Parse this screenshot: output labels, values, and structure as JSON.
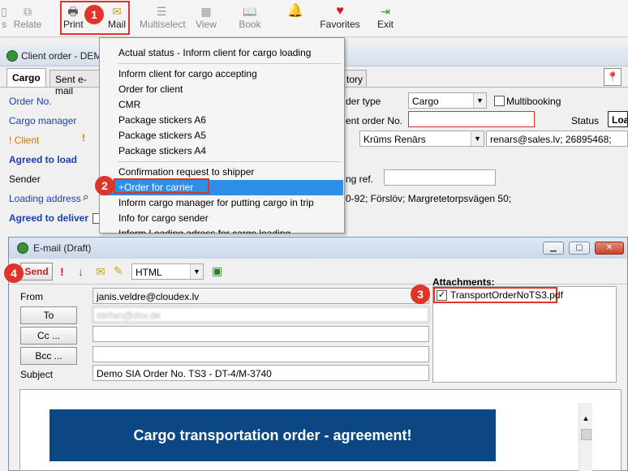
{
  "toolbar": {
    "relate": "Relate",
    "print": "Print",
    "mail": "Mail",
    "multiselect": "Multiselect",
    "view": "View",
    "book": "Book",
    "favorites": "Favorites",
    "exit": "Exit"
  },
  "steps": {
    "s1": "1",
    "s2": "2",
    "s3": "3",
    "s4": "4"
  },
  "client_order": {
    "title": "Client order - DEM",
    "tabs": {
      "cargo": "Cargo",
      "sent_email": "Sent e-mail",
      "history": "tory"
    },
    "labels": {
      "order_no": "Order No.",
      "cargo_manager": "Cargo manager",
      "client": "! Client",
      "agreed_to_load": "Agreed to load",
      "sender": "Sender",
      "loading_address": "Loading address",
      "agreed_to_deliver": "Agreed to deliver",
      "order_type": "der type",
      "client_order_no": "ent order No.",
      "status": "Status",
      "ref": "ng ref.",
      "multibooking": "Multibooking"
    },
    "values": {
      "order_type": "Cargo",
      "contact": "Krūms Renārs",
      "contact_info": "renars@sales.lv; 26895468;",
      "status": "Loa",
      "address": "0-92; Förslöv; Margretetorpsvägen 50;"
    }
  },
  "menu": {
    "items": [
      "Actual status - Inform client for cargo loading",
      "Inform client for cargo accepting",
      "Order for client",
      "CMR",
      "Package stickers A6",
      "Package stickers A5",
      "Package stickers A4",
      "Confirmation request to shipper",
      "+Order for carrier",
      "Inform cargo manager for putting cargo in trip",
      "Info for cargo sender",
      "Inform Loading adress for cargo loading"
    ]
  },
  "email": {
    "title": "E-mail (Draft)",
    "send": "Send",
    "format": "HTML",
    "labels": {
      "from": "From",
      "to": "To",
      "cc": "Cc ...",
      "bcc": "Bcc ...",
      "subject": "Subject",
      "attachments": "Attachments:"
    },
    "from": "janis.veldre@cloudex.lv",
    "to": "stefan@dsv.de",
    "cc": "",
    "bcc": "",
    "subject": "Demo SIA Order No. TS3 - DT-4/M-3740",
    "attachment": "TransportOrderNoTS3.pdf",
    "banner": "Cargo transportation order - agreement!"
  },
  "colors": {
    "highlight": "#e0342b",
    "selected": "#2f8ee5",
    "banner": "#0d4783"
  }
}
